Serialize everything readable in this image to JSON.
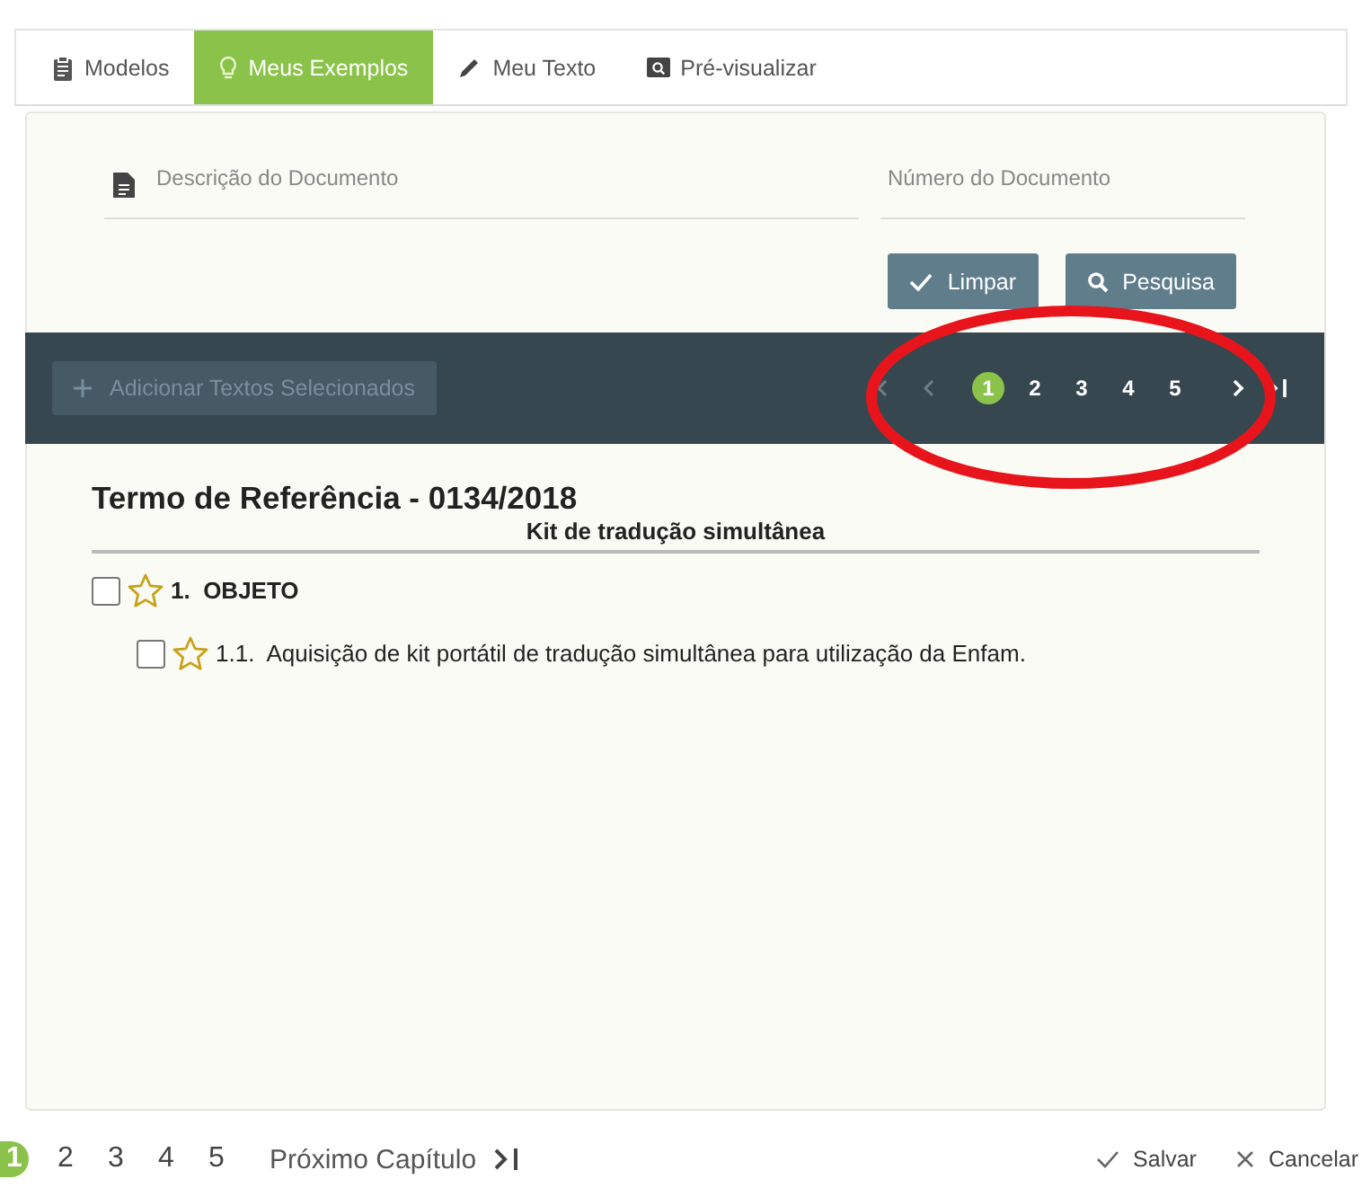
{
  "tabs": [
    {
      "label": "Modelos",
      "selected": false
    },
    {
      "label": "Meus Exemplos",
      "selected": true
    },
    {
      "label": "Meu Texto",
      "selected": false
    },
    {
      "label": "Pré-visualizar",
      "selected": false
    }
  ],
  "search": {
    "description": {
      "placeholder": "Descrição do Documento"
    },
    "number": {
      "placeholder": "Número do Documento"
    },
    "buttons": [
      {
        "kind": "clear",
        "label": "Limpar"
      },
      {
        "kind": "search",
        "label": "Pesquisa"
      }
    ]
  },
  "toolbar": {
    "add_button": {
      "label": "Adicionar Textos Selecionados",
      "disabled": true
    },
    "pager": [
      {
        "label": "1",
        "selected": true
      },
      {
        "label": "2",
        "selected": false
      },
      {
        "label": "3",
        "selected": false
      },
      {
        "label": "4",
        "selected": false
      },
      {
        "label": "5",
        "selected": false
      }
    ]
  },
  "document": {
    "title": "Termo de Referência - 0134/2018",
    "subtitle": "Kit de tradução simultânea",
    "items": [
      {
        "number": "1.",
        "text": "OBJETO",
        "checked": false,
        "starred": false,
        "children": [
          {
            "number": "1.1.",
            "text": "Aquisição de kit portátil de tradução simultânea para utilização da Enfam.",
            "checked": false,
            "starred": false
          }
        ]
      }
    ]
  },
  "footer": {
    "pages": [
      {
        "label": "1",
        "selected": true
      },
      {
        "label": "2",
        "selected": false
      },
      {
        "label": "3",
        "selected": false
      },
      {
        "label": "4",
        "selected": false
      },
      {
        "label": "5",
        "selected": false
      }
    ],
    "next_chapter": "Próximo Capítulo",
    "actions": [
      {
        "kind": "save",
        "label": "Salvar"
      },
      {
        "kind": "cancel",
        "label": "Cancelar"
      }
    ]
  }
}
